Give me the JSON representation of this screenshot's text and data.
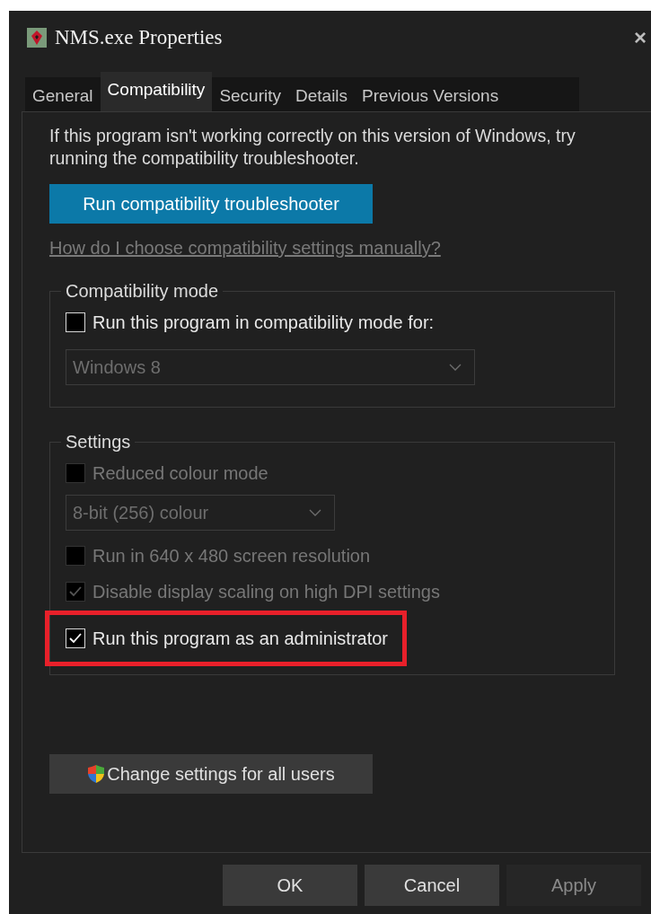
{
  "window": {
    "title": "NMS.exe Properties",
    "close": "×"
  },
  "tabs": [
    {
      "label": "General",
      "selected": false
    },
    {
      "label": "Compatibility",
      "selected": true
    },
    {
      "label": "Security",
      "selected": false
    },
    {
      "label": "Details",
      "selected": false
    },
    {
      "label": "Previous Versions",
      "selected": false
    }
  ],
  "intro": "If this program isn't working correctly on this version of Windows, try running the compatibility troubleshooter.",
  "troubleshooter_button": "Run compatibility troubleshooter",
  "help_link": "How do I choose compatibility settings manually?",
  "groups": [
    {
      "title": "Compatibility mode",
      "items": [
        {
          "kind": "checkbox",
          "label": "Run this program in compatibility mode for:",
          "checked": false,
          "disabled": false,
          "highlighted": false
        },
        {
          "kind": "dropdown",
          "value": "Windows 8",
          "disabled": true,
          "wide": true
        }
      ]
    },
    {
      "title": "Settings",
      "items": [
        {
          "kind": "checkbox",
          "label": "Reduced colour mode",
          "checked": false,
          "disabled": true,
          "highlighted": false
        },
        {
          "kind": "dropdown",
          "value": "8-bit (256) colour",
          "disabled": true,
          "wide": false
        },
        {
          "kind": "checkbox",
          "label": "Run in 640 x 480 screen resolution",
          "checked": false,
          "disabled": true,
          "highlighted": false
        },
        {
          "kind": "checkbox",
          "label": "Disable display scaling on high DPI settings",
          "checked": true,
          "disabled": true,
          "highlighted": false
        },
        {
          "kind": "checkbox",
          "label": "Run this program as an administrator",
          "checked": true,
          "disabled": false,
          "highlighted": true
        }
      ]
    }
  ],
  "all_users_button": "Change settings for all users",
  "buttons": [
    {
      "label": "OK",
      "disabled": false
    },
    {
      "label": "Cancel",
      "disabled": false
    },
    {
      "label": "Apply",
      "disabled": true
    }
  ]
}
